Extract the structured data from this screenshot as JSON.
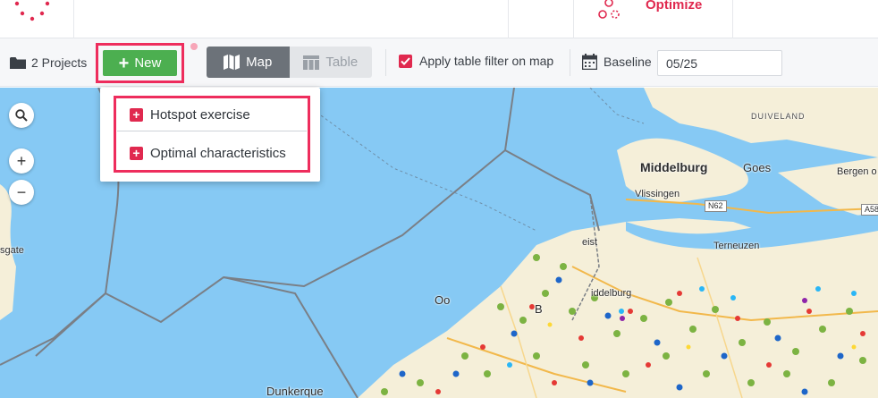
{
  "header": {
    "app_label": "Optimize"
  },
  "toolbar": {
    "projects_label": "2 Projects",
    "new_label": "New",
    "view_map_label": "Map",
    "view_table_label": "Table",
    "filter_checked": true,
    "filter_label": "Apply table filter on map",
    "baseline_label": "Baseline",
    "baseline_value": "05/25"
  },
  "dropdown": {
    "items": [
      {
        "label": "Hotspot exercise"
      },
      {
        "label": "Optimal characteristics"
      }
    ]
  },
  "map": {
    "places": {
      "middelburg": "Middelburg",
      "goes": "Goes",
      "vlissingen": "Vlissingen",
      "bergen": "Bergen o",
      "terneuzen": "Terneuzen",
      "duiveland": "DUIVELAND",
      "dunkerque": "Dunkerque",
      "oostende": "Oo",
      "brugge": "B",
      "midd2": "iddelburg",
      "heist": "eist",
      "sgate": "sgate"
    },
    "roads": {
      "n62": "N62",
      "a58": "A58"
    }
  },
  "colors": {
    "accent": "#e0294f",
    "new_button": "#4caf50",
    "highlight_frame": "#ee2d5d",
    "sea": "#86c9f4",
    "land": "#f5efd9"
  }
}
